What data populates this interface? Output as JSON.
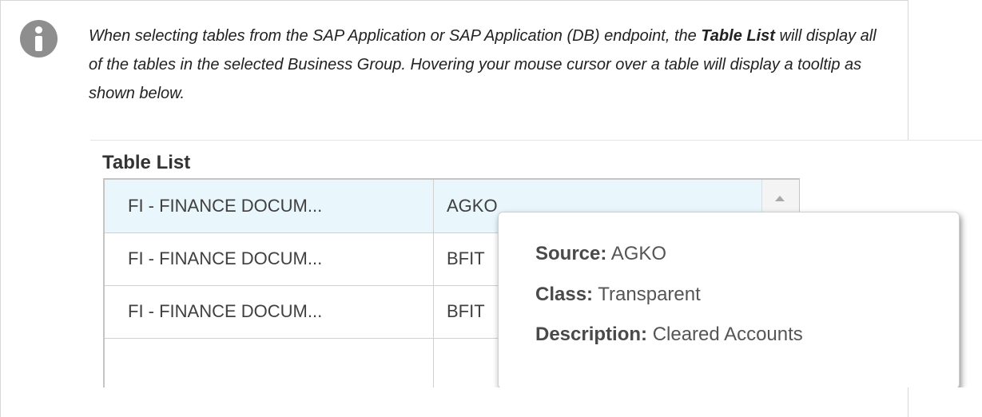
{
  "note": {
    "icon": "info-icon",
    "text_before": "When selecting tables from the SAP Application or SAP Application (DB) endpoint, the ",
    "bold_text": "Table List",
    "text_after": " will display all of the tables in the selected Business Group. Hovering your mouse cursor over a table will display a tooltip as shown below."
  },
  "table_list": {
    "title": "Table List",
    "rows": [
      {
        "group": "FI - FINANCE DOCUM...",
        "table": "AGKO",
        "selected": true
      },
      {
        "group": "FI - FINANCE DOCUM...",
        "table": "BFIT",
        "selected": false
      },
      {
        "group": "FI - FINANCE DOCUM...",
        "table": "BFIT",
        "selected": false
      },
      {
        "group": "",
        "table": "",
        "selected": false
      }
    ]
  },
  "tooltip": {
    "source_label": "Source:",
    "source_value": "AGKO",
    "class_label": "Class:",
    "class_value": "Transparent",
    "description_label": "Description:",
    "description_value": "Cleared Accounts"
  },
  "colors": {
    "selected_row": "#e9f6fb",
    "icon": "#8e8e8e"
  }
}
